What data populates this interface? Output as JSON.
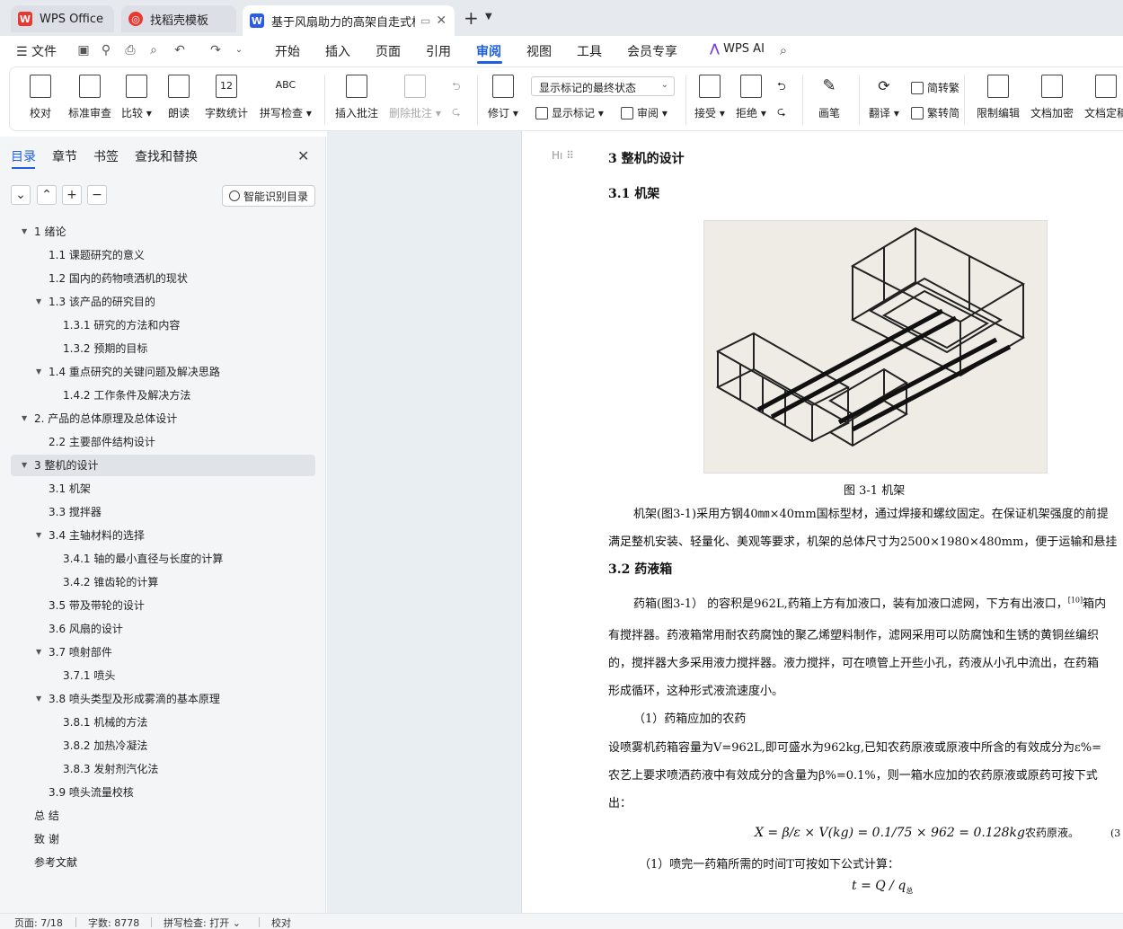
{
  "tabs": [
    {
      "label": "WPS Office",
      "icon": "wps-icon"
    },
    {
      "label": "找稻壳模板",
      "icon": "docer-icon"
    },
    {
      "label": "基于风扇助力的高架自走式棉花",
      "icon": "word-doc-icon"
    }
  ],
  "menu": {
    "file": "文件",
    "items": [
      "开始",
      "插入",
      "页面",
      "引用",
      "审阅",
      "视图",
      "工具",
      "会员专享"
    ],
    "active": "审阅",
    "ai": "WPS AI"
  },
  "ribbon": {
    "proofread": "校对",
    "standard_review": "标准审查",
    "compare": "比较",
    "read_aloud": "朗读",
    "word_count": "字数统计",
    "spell_check": "拼写检查",
    "insert_comment": "插入批注",
    "delete_comment": "删除批注",
    "track_changes": "修订",
    "markup_dropdown": "显示标记的最终状态",
    "show_markup": "显示标记",
    "review": "审阅",
    "accept": "接受",
    "reject": "拒绝",
    "pen": "画笔",
    "translate": "翻译",
    "to_traditional": "简转繁",
    "to_simplified": "繁转简",
    "restrict_edit": "限制编辑",
    "encrypt": "文档加密",
    "finalize": "文档定稿"
  },
  "nav": {
    "tabs": [
      "目录",
      "章节",
      "书签",
      "查找和替换"
    ],
    "smart_toc": "智能识别目录",
    "toc": [
      {
        "label": "1  绪论",
        "level": 0,
        "expand": true
      },
      {
        "label": "1.1 课题研究的意义",
        "level": 1
      },
      {
        "label": "1.2 国内的药物喷洒机的现状",
        "level": 1
      },
      {
        "label": "1.3  该产品的研究目的",
        "level": 1,
        "expand": true
      },
      {
        "label": "1.3.1  研究的方法和内容",
        "level": 2
      },
      {
        "label": "1.3.2 预期的目标",
        "level": 2
      },
      {
        "label": "1.4 重点研究的关键问题及解决思路",
        "level": 1,
        "expand": true
      },
      {
        "label": "1.4.2 工作条件及解决方法",
        "level": 2
      },
      {
        "label": "2.  产品的总体原理及总体设计",
        "level": 0,
        "expand": true
      },
      {
        "label": "2.2  主要部件结构设计",
        "level": 1
      },
      {
        "label": "3  整机的设计",
        "level": 0,
        "expand": true,
        "selected": true
      },
      {
        "label": "3.1  机架",
        "level": 1
      },
      {
        "label": "3.3  搅拌器",
        "level": 1
      },
      {
        "label": "3.4  主轴材料的选择",
        "level": 1,
        "expand": true
      },
      {
        "label": "3.4.1  轴的最小直径与长度的计算",
        "level": 2
      },
      {
        "label": "3.4.2  锥齿轮的计算",
        "level": 2
      },
      {
        "label": "3.5  带及带轮的设计",
        "level": 1
      },
      {
        "label": "3.6  风扇的设计",
        "level": 1
      },
      {
        "label": "3.7 喷射部件",
        "level": 1,
        "expand": true
      },
      {
        "label": "3.7.1  喷头",
        "level": 2
      },
      {
        "label": "3.8 喷头类型及形成雾滴的基本原理",
        "level": 1,
        "expand": true
      },
      {
        "label": "3.8.1  机械的方法",
        "level": 2
      },
      {
        "label": "3.8.2  加热冷凝法",
        "level": 2
      },
      {
        "label": "3.8.3  发射剂汽化法",
        "level": 2
      },
      {
        "label": "3.9  喷头流量校核",
        "level": 1
      },
      {
        "label": "总    结",
        "level": 0
      },
      {
        "label": "致    谢",
        "level": 0
      },
      {
        "label": "参考文献",
        "level": 0
      }
    ]
  },
  "doc": {
    "h3": "3  整机的设计",
    "h31": "3.1  机架",
    "fig_caption": "图  3-1  机架",
    "p1a": "机架(图3-1)采用方钢40㎜×40mm国标型材，通过焊接和螺纹固定。在保证机架强度的前提",
    "p1b": "满足整机安装、轻量化、美观等要求，机架的总体尺寸为2500×1980×480mm，便于运输和悬挂",
    "h32": "3.2  药液箱",
    "p2a": "药箱(图3-1）  的容积是962L,药箱上方有加液口，装有加液口滤网，下方有出液口，",
    "p2a_sup": "[10]",
    "p2a_tail": "箱内",
    "p2b": "有搅拌器。药液箱常用耐农药腐蚀的聚乙烯塑料制作，滤网采用可以防腐蚀和生锈的黄铜丝编织",
    "p2c": "的，搅拌器大多采用液力搅拌器。液力搅拌，可在喷管上开些小孔，药液从小孔中流出，在药箱",
    "p2d": "形成循环，这种形式液流速度小。",
    "p3": "（1）药箱应加的农药",
    "p4a": "设喷雾机药箱容量为V=962L,即可盛水为962kg,已知农药原液或原液中所含的有效成分为ε%=",
    "p4b": "农艺上要求喷洒药液中有效成分的含量为β%=0.1%，则一箱水应加的农药原液或原药可按下式",
    "p4c": "出：",
    "formula1": "X = β/ε × V(kg) = 0.1/75 × 962 = 0.128kg",
    "formula1_suffix": "农药原液。",
    "eq_no": "(3",
    "p5": "（1）喷完一药箱所需的时间T可按如下公式计算：",
    "formula2": "t = Q / q",
    "formula2_sub": "总"
  },
  "status": {
    "page": "页面: 7/18",
    "words": "字数: 8778",
    "spell": "拼写检查: 打开",
    "proof": "校对"
  },
  "colors": {
    "accent": "#1d5fe0",
    "wps_red": "#e8382f",
    "word_blue": "#2b5ce6"
  }
}
